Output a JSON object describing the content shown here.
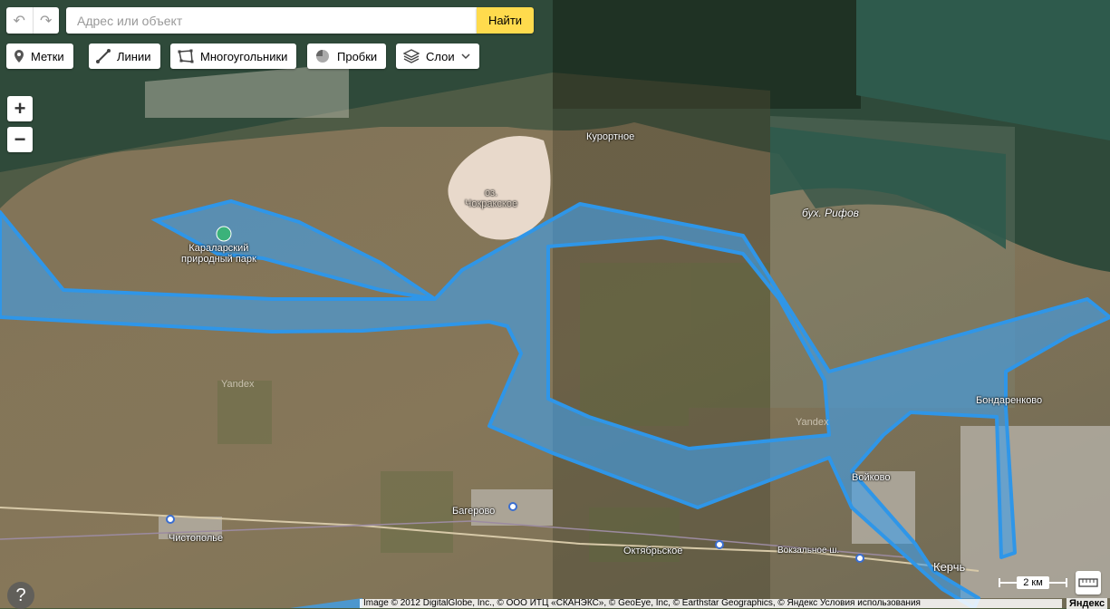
{
  "toolbar": {
    "search_placeholder": "Адрес или объект",
    "find_label": "Найти",
    "placemarks_label": "Метки",
    "lines_label": "Линии",
    "polygons_label": "Многоугольники",
    "traffic_label": "Пробки",
    "layers_label": "Слои"
  },
  "places": {
    "kurortnoe": "Курортное",
    "lake": "оз.\nЧокракское",
    "park": "Караларский\nприродный парк",
    "bay": "бух. Рифов",
    "bondarenkovo": "Бондаренково",
    "voykovo": "Войково",
    "bagerovo": "Багерово",
    "chistopole": "Чистополье",
    "oktyabrskoe": "Октябрьское",
    "kerch": "Керчь",
    "street": "Вокзальное ш.",
    "yandex_watermark": "Yandex"
  },
  "scale": {
    "label": "2 км"
  },
  "copyright": "Image © 2012 DigitalGlobe, Inc., © ООО ИТЦ «СКАНЭКС», © GeoEye, Inc, © Earthstar Geographics, © Яндекс Условия использования",
  "logo": "Яндекс",
  "help": "?",
  "colors": {
    "polygon_fill": "#3fa0ec",
    "polygon_stroke": "#2f96e8",
    "find_button": "#ffdb4d"
  }
}
